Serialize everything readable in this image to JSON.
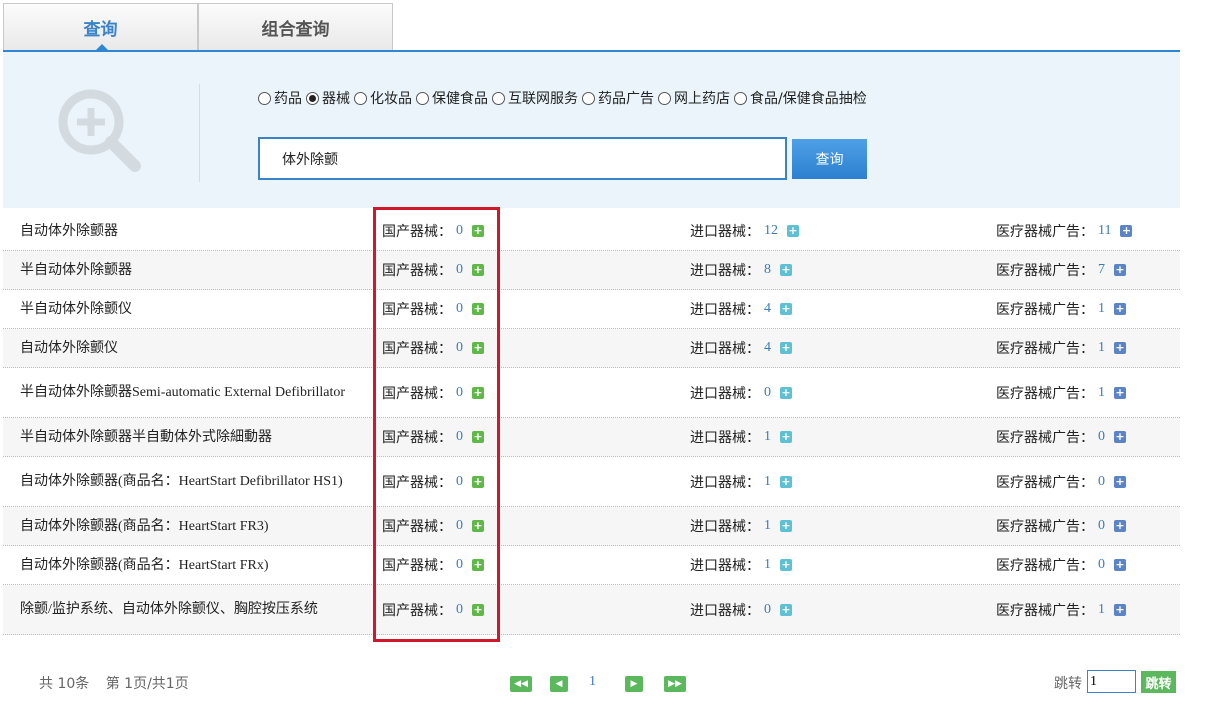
{
  "tabs": [
    {
      "label": "查询",
      "active": true
    },
    {
      "label": "组合查询",
      "active": false
    }
  ],
  "search": {
    "categories": [
      {
        "label": "药品",
        "checked": false
      },
      {
        "label": "器械",
        "checked": true
      },
      {
        "label": "化妆品",
        "checked": false
      },
      {
        "label": "保健食品",
        "checked": false
      },
      {
        "label": "互联网服务",
        "checked": false
      },
      {
        "label": "药品广告",
        "checked": false
      },
      {
        "label": "网上药店",
        "checked": false
      },
      {
        "label": "食品/保健食品抽检",
        "checked": false
      }
    ],
    "query": "体外除颤",
    "button_label": "查询"
  },
  "results": {
    "col_labels": {
      "domestic": "国产器械：",
      "imported": "进口器械：",
      "ads": "医疗器械广告："
    },
    "rows": [
      {
        "name": "自动体外除颤器",
        "domestic": "0",
        "imported": "12",
        "ads": "11",
        "tall": false
      },
      {
        "name": "半自动体外除颤器",
        "domestic": "0",
        "imported": "8",
        "ads": "7",
        "tall": false
      },
      {
        "name": "半自动体外除颤仪",
        "domestic": "0",
        "imported": "4",
        "ads": "1",
        "tall": false
      },
      {
        "name": "自动体外除颤仪",
        "domestic": "0",
        "imported": "4",
        "ads": "1",
        "tall": false
      },
      {
        "name": "半自动体外除颤器Semi-automatic External Defibrillator",
        "domestic": "0",
        "imported": "0",
        "ads": "1",
        "tall": true
      },
      {
        "name": "半自动体外除颤器半自動体外式除細動器",
        "domestic": "0",
        "imported": "1",
        "ads": "0",
        "tall": false
      },
      {
        "name": "自动体外除颤器(商品名：HeartStart Defibrillator HS1)",
        "domestic": "0",
        "imported": "1",
        "ads": "0",
        "tall": true
      },
      {
        "name": "自动体外除颤器(商品名：HeartStart FR3)",
        "domestic": "0",
        "imported": "1",
        "ads": "0",
        "tall": false
      },
      {
        "name": "自动体外除颤器(商品名：HeartStart FRx)",
        "domestic": "0",
        "imported": "1",
        "ads": "0",
        "tall": false
      },
      {
        "name": "除颤/监护系统、自动体外除颤仪、胸腔按压系统",
        "domestic": "0",
        "imported": "0",
        "ads": "1",
        "tall": true
      }
    ]
  },
  "pager": {
    "total": "共 10条",
    "page_info": "第 1页/共1页",
    "current_page": "1",
    "jump_label": "跳转",
    "jump_value": "1",
    "jump_button": "跳转"
  },
  "colors": {
    "accent": "#2f86d3",
    "highlight": "#d0182a",
    "green": "#5cb85c"
  }
}
